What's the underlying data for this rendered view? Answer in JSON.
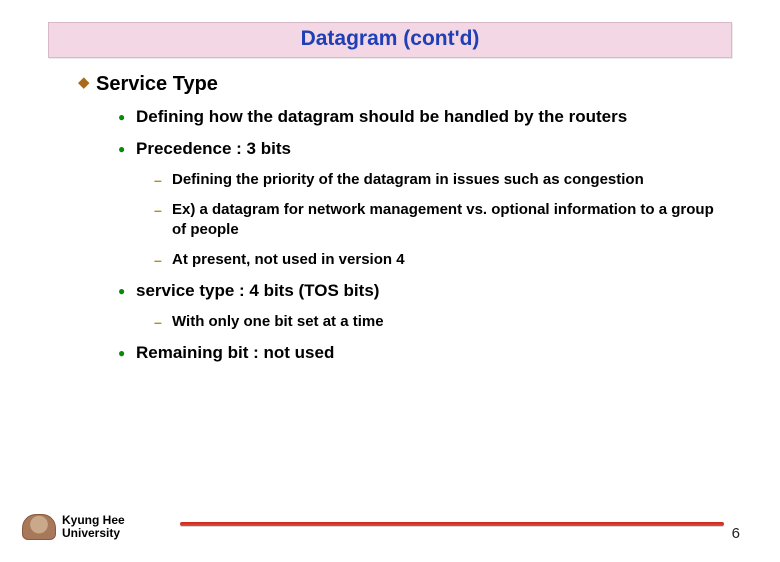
{
  "title": "Datagram (cont'd)",
  "heading": "Service Type",
  "bullets": [
    {
      "text": "Defining how the datagram should be handled by the routers",
      "sub": []
    },
    {
      "text": "Precedence : 3 bits",
      "sub": [
        "Defining the priority of the datagram in issues  such as congestion",
        "Ex) a datagram for network management vs. optional information to a group of people",
        "At present, not used in version 4"
      ]
    },
    {
      "text": "service type : 4 bits (TOS bits)",
      "sub": [
        "With only one bit set at a time"
      ]
    },
    {
      "text": "Remaining bit : not used",
      "sub": []
    }
  ],
  "footer": {
    "university_line1": "Kyung Hee",
    "university_line2": "University",
    "page": "6"
  }
}
